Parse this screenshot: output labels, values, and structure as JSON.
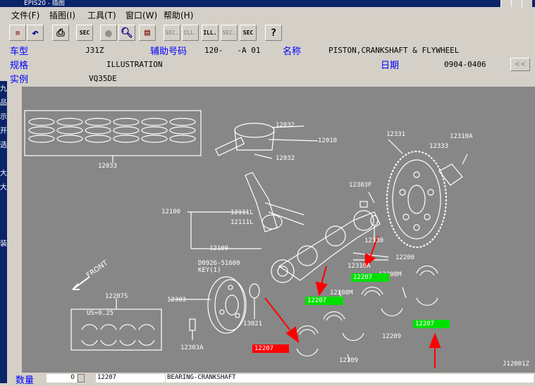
{
  "window": {
    "title": "EPIS20 - 插图"
  },
  "menu": [
    "文件(F)",
    "插图(I)",
    "工具(T)",
    "窗口(W)",
    "帮助(H)"
  ],
  "toolbar": {
    "buttons": [
      "SEC",
      "SEC.",
      "ILL.",
      "ILL.",
      "SEC.",
      "SEC"
    ]
  },
  "info": {
    "car_type_label": "车型",
    "car_type": "J31Z",
    "aux_label": "辅助号码",
    "aux_value": "120-   -A 01",
    "name_label": "名称",
    "name_value": "PISTON,CRANKSHAFT & FLYWHEEL",
    "spec_label": "规格",
    "spec_value": "ILLUSTRATION",
    "date_label": "日期",
    "date_value": "0904-0406",
    "example_label": "实例",
    "example_value": "VQ35DE",
    "nav_button": "<<"
  },
  "left_strip": [
    "九",
    "品",
    "示",
    "开",
    "选",
    "大",
    "大",
    "装"
  ],
  "diagram": {
    "labels": {
      "p12033": "12033",
      "p12032a": "12032",
      "p12010": "12010",
      "p12032b": "12032",
      "p12331": "12331",
      "p12310a": "12310A",
      "p12333": "12333",
      "p12303f": "12303F",
      "p12100": "12100",
      "p12111a": "12111L",
      "p12111b": "12111L",
      "p12109": "12109",
      "p12330": "12330",
      "p12200": "12200",
      "key_part": "D0926-51600",
      "key_qty": "KEY(1)",
      "p12208m_a": "12208M",
      "p12208m_b": "12208M",
      "p12207s": "12207S",
      "us": "US=0.25",
      "p12303": "12303",
      "p13021": "13021",
      "p12209a": "12209",
      "p12209b": "12209",
      "p12303a": "12303A",
      "front": "FRONT",
      "fig_code": "J12001Z",
      "hl1": "12207",
      "hl2": "12207",
      "hl3": "12207",
      "hl_red": "12207",
      "p12310a_h": "12310A"
    }
  },
  "bottom": {
    "qty_label": "数量",
    "qty_value": "0",
    "part_number": "12207",
    "part_name": "BEARING-CRANKSHAFT"
  },
  "colors": {
    "green": "#00e000",
    "red": "#ff0000",
    "diagram_bg": "#878787"
  }
}
